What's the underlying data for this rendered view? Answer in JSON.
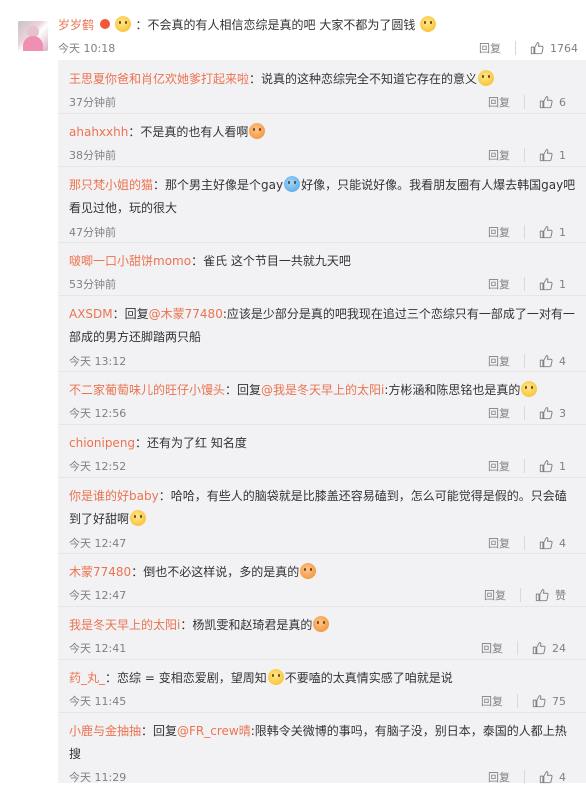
{
  "main_comment": {
    "username": "岁岁鹤",
    "text": "：不会真的有人相信恋综是真的吧 大家不都为了圆钱",
    "time": "今天 10:18",
    "reply_label": "回复",
    "likes": "1764"
  },
  "replies": [
    {
      "username": "王思夏你爸和肖亿欢她爹打起来啦",
      "text": "：说真的这种恋综完全不知道它存在的意义",
      "time": "37分钟前",
      "reply_label": "回复",
      "likes": "6"
    },
    {
      "username": "ahahxxhh",
      "text": "：不是真的也有人看啊",
      "time": "38分钟前",
      "reply_label": "回复",
      "likes": "1"
    },
    {
      "username": "那只梵小姐的猫",
      "text_a": "：那个男主好像是个gay",
      "text_b": "好像，只能说好像。我看朋友圈有人爆去韩国gay吧看见过他，玩的很大",
      "time": "47分钟前",
      "reply_label": "回复",
      "likes": "1"
    },
    {
      "username": "啵唧一口小甜饼momo",
      "text": "：雀氏 这个节目一共就九天吧",
      "time": "53分钟前",
      "reply_label": "回复",
      "likes": "1"
    },
    {
      "username": "AXSDM",
      "prefix": "：回复",
      "mention": "@木蒙77480",
      "text": ":应该是少部分是真的吧我现在追过三个恋综只有一部成了一对有一部成的男方还脚踏两只船",
      "time": "今天 13:12",
      "reply_label": "回复",
      "likes": "4"
    },
    {
      "username": "不二家葡萄味儿的旺仔小馒头",
      "prefix": "：回复",
      "mention": "@我是冬天早上的太阳i",
      "text": ":方彬涵和陈思铭也是真的",
      "time": "今天 12:56",
      "reply_label": "回复",
      "likes": "3"
    },
    {
      "username": "chionipeng",
      "text": "：还有为了红 知名度",
      "time": "今天 12:52",
      "reply_label": "回复",
      "likes": "1"
    },
    {
      "username": "你是谁的好baby",
      "text": "：哈哈，有些人的脑袋就是比膝盖还容易磕到，怎么可能觉得是假的。只会磕到了好甜啊",
      "time": "今天 12:47",
      "reply_label": "回复",
      "likes": "4"
    },
    {
      "username": "木蒙77480",
      "text": "：倒也不必这样说，多的是真的",
      "time": "今天 12:47",
      "reply_label": "回复",
      "likes": "赞"
    },
    {
      "username": "我是冬天早上的太阳i",
      "text": "：杨凯雯和赵琦君是真的",
      "time": "今天 12:41",
      "reply_label": "回复",
      "likes": "24"
    },
    {
      "username": "药_丸_",
      "text_a": "：恋综 = 变相恋爱剧，望周知",
      "text_b": "不要嗑的太真情实感了咱就是说",
      "time": "今天 11:45",
      "reply_label": "回复",
      "likes": "75"
    },
    {
      "username": "小鹿与金抽抽",
      "prefix": "：回复",
      "mention": "@FR_crew晴",
      "text": ":限韩令关微博的事吗，有脑子没，别日本，泰国的人都上热搜",
      "time": "今天 11:29",
      "reply_label": "回复",
      "likes": "4"
    }
  ],
  "colors": {
    "username": "#eb7350",
    "link": "#eb7350",
    "meta": "#808080",
    "reply_bg": "#f2f2f5"
  },
  "icons": {
    "like": "thumbs-up-icon",
    "emoji": "emoji-icon"
  }
}
